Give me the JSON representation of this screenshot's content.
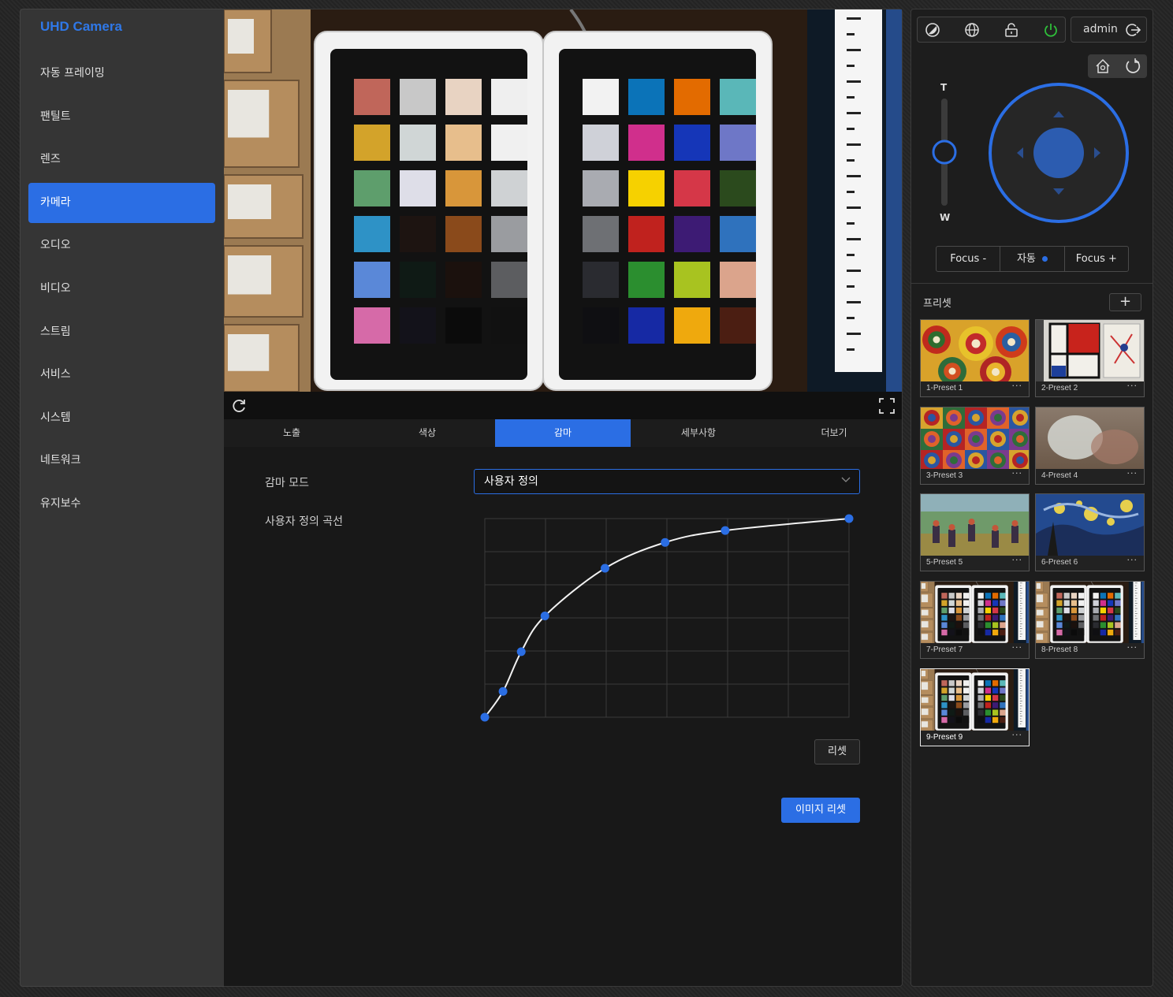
{
  "app": {
    "title": "UHD Camera"
  },
  "nav": {
    "items": [
      {
        "label": "자동 프레이밍"
      },
      {
        "label": "팬틸트"
      },
      {
        "label": "렌즈"
      },
      {
        "label": "카메라",
        "active": true
      },
      {
        "label": "오디오"
      },
      {
        "label": "비디오"
      },
      {
        "label": "스트림"
      },
      {
        "label": "서비스"
      },
      {
        "label": "시스템"
      },
      {
        "label": "네트워크"
      },
      {
        "label": "유지보수"
      }
    ]
  },
  "tabs": [
    {
      "label": "노출"
    },
    {
      "label": "색상"
    },
    {
      "label": "감마",
      "active": true
    },
    {
      "label": "세부사항"
    },
    {
      "label": "더보기"
    }
  ],
  "gamma": {
    "mode_label": "감마 모드",
    "mode_value": "사용자 정의",
    "curve_label": "사용자 정의 곡선",
    "curve_points": [
      [
        0,
        0
      ],
      [
        0.05,
        0.13
      ],
      [
        0.1,
        0.33
      ],
      [
        0.165,
        0.51
      ],
      [
        0.33,
        0.75
      ],
      [
        0.495,
        0.88
      ],
      [
        0.66,
        0.94
      ],
      [
        1,
        1
      ]
    ],
    "reset_label": "리셋",
    "image_reset_label": "이미지 리셋"
  },
  "header": {
    "user": "admin"
  },
  "ptz": {
    "zoom_top": "T",
    "zoom_bottom": "W",
    "focus_minus": "Focus -",
    "focus_auto": "자동",
    "focus_plus": "Focus +"
  },
  "presets": {
    "title": "프리셋",
    "add": "+",
    "more": "···",
    "items": [
      {
        "name": "1-Preset 1",
        "thumb": "kandinsky-circles"
      },
      {
        "name": "2-Preset 2",
        "thumb": "mondrian"
      },
      {
        "name": "3-Preset 3",
        "thumb": "kandinsky-squares"
      },
      {
        "name": "4-Preset 4",
        "thumb": "monet"
      },
      {
        "name": "5-Preset 5",
        "thumb": "seurat"
      },
      {
        "name": "6-Preset 6",
        "thumb": "starry-night"
      },
      {
        "name": "7-Preset 7",
        "thumb": "colorchecker"
      },
      {
        "name": "8-Preset 8",
        "thumb": "colorchecker"
      },
      {
        "name": "9-Preset 9",
        "thumb": "colorchecker",
        "selected": true
      }
    ]
  },
  "colors": {
    "accent": "#2b6ee4",
    "power": "#2fbf3a"
  }
}
